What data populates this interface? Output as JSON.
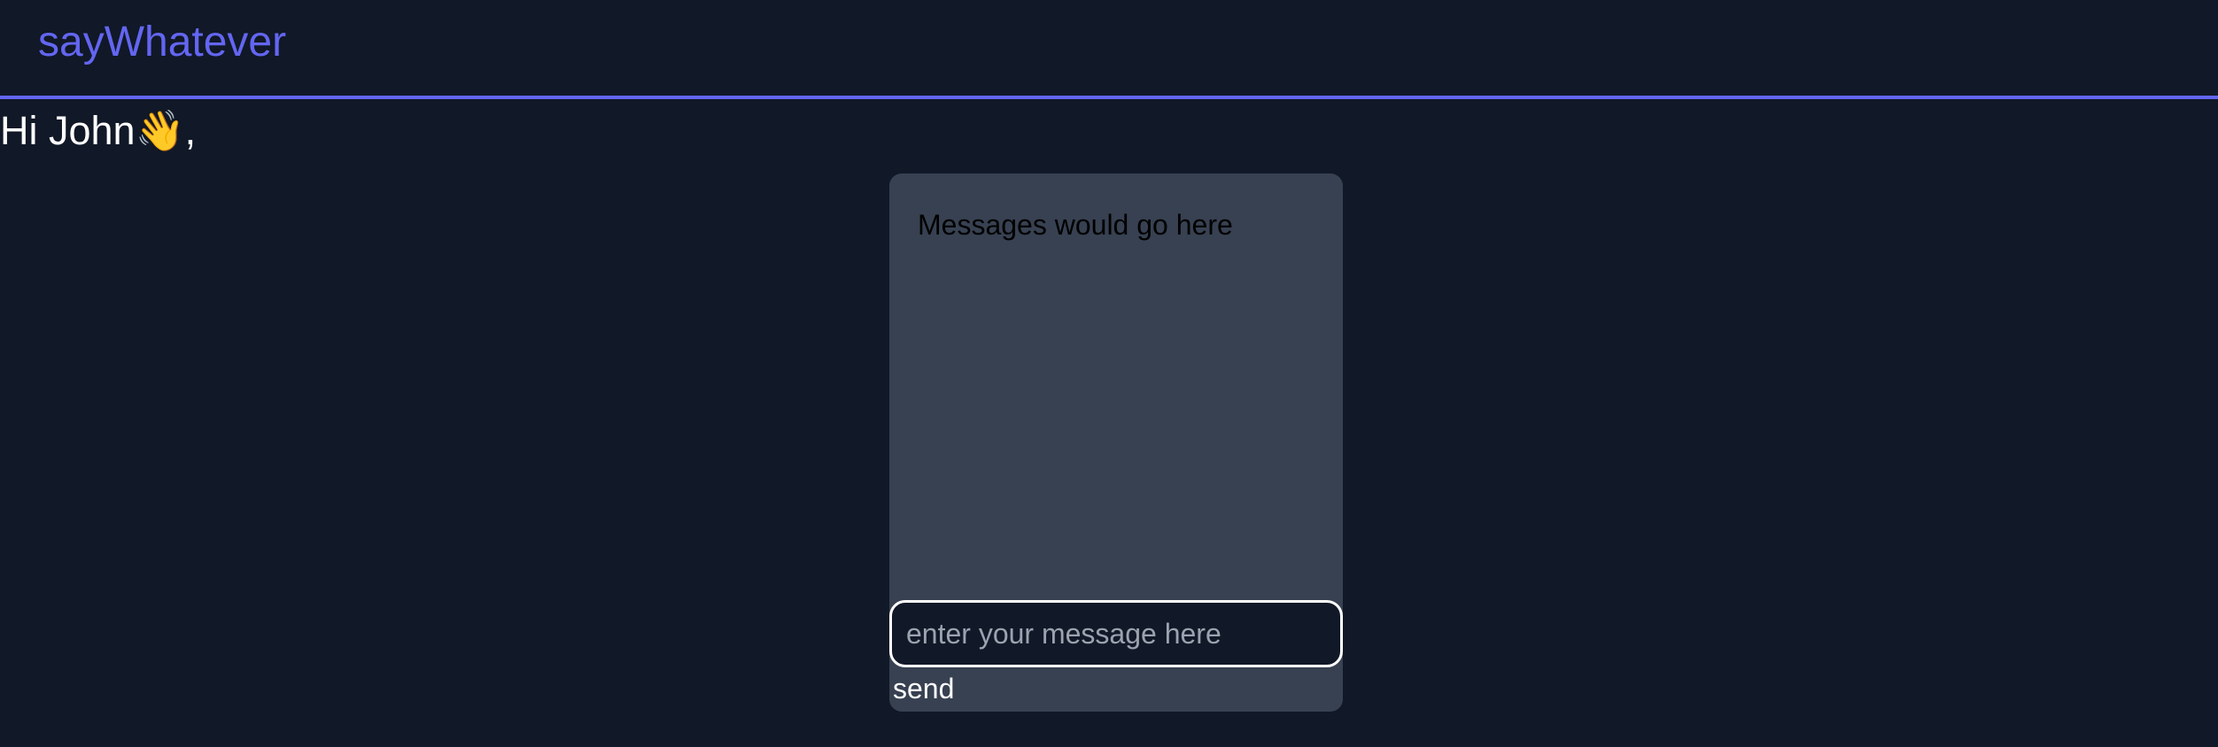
{
  "navbar": {
    "brand": "sayWhatever",
    "accent_color": "#6366f1"
  },
  "greeting": {
    "text": "Hi John👋,"
  },
  "chat": {
    "messages_placeholder": "Messages would go here",
    "input_placeholder": "enter your message here",
    "input_value": "",
    "send_label": "send"
  },
  "colors": {
    "background": "#111827",
    "card": "#374151",
    "text": "#ffffff"
  }
}
